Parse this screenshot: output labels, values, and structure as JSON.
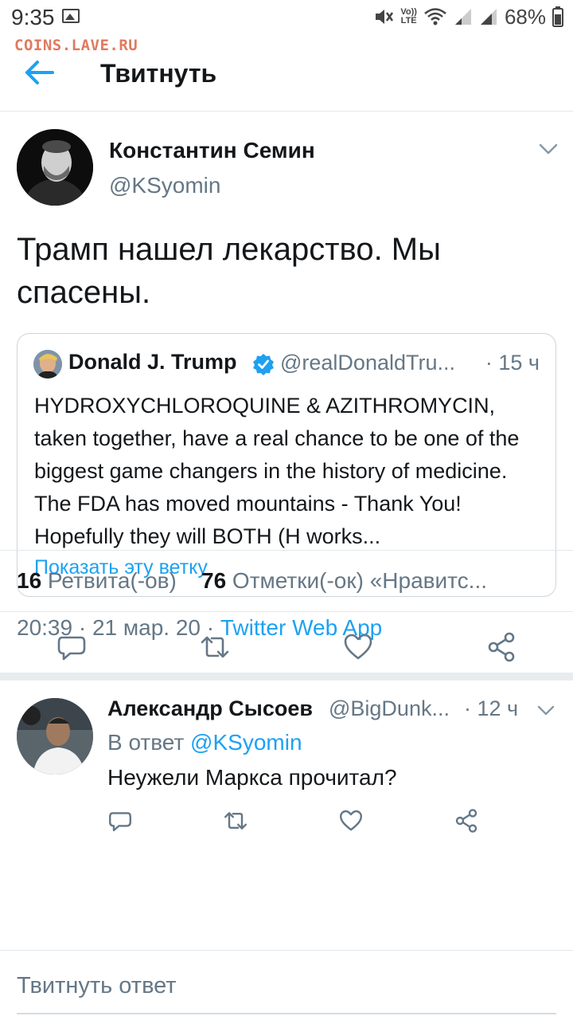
{
  "status_bar": {
    "time": "9:35",
    "lte_top": "Vo))",
    "lte_bottom": "LTE",
    "battery": "68%"
  },
  "watermark": "COINS.LAVE.RU",
  "header": {
    "title": "Твитнуть"
  },
  "tweet": {
    "author_name": "Константин Семин",
    "author_handle": "@KSyomin",
    "text": "Трамп нашел лекарство. Мы спасены.",
    "quote": {
      "name": "Donald J. Trump",
      "handle": "@realDonaldTru...",
      "time": "· 15 ч",
      "text": "HYDROXYCHLOROQUINE & AZITHROMYCIN, taken together, have a real chance to be one of the biggest game changers in the history of medicine. The FDA has moved mountains - Thank You! Hopefully they will BOTH (H works...",
      "link": "Показать эту ветку"
    },
    "meta_time": "20:39 · 21 мар. 20 · ",
    "meta_source": "Twitter Web App",
    "retweets_count": "16",
    "retweets_label": " Ретвита(-ов)",
    "likes_count": "76",
    "likes_label": " Отметки(-ок) «Нравитс..."
  },
  "reply": {
    "author_name": "Александр Сысоев",
    "author_handle": "@BigDunk...",
    "time": "· 12 ч",
    "in_reply_prefix": "В ответ ",
    "in_reply_mention": "@KSyomin",
    "text": "Неужели Маркса прочитал?"
  },
  "compose": {
    "placeholder": "Твитнуть ответ"
  },
  "colors": {
    "accent": "#1da1f2",
    "secondary_text": "#657786",
    "border": "#e1e8ed"
  },
  "icons": {
    "back": "arrow-left-icon",
    "caret": "chevron-down-icon",
    "verified": "verified-badge-icon",
    "reply": "comment-icon",
    "retweet": "retweet-icon",
    "like": "heart-icon",
    "share": "share-icon"
  }
}
